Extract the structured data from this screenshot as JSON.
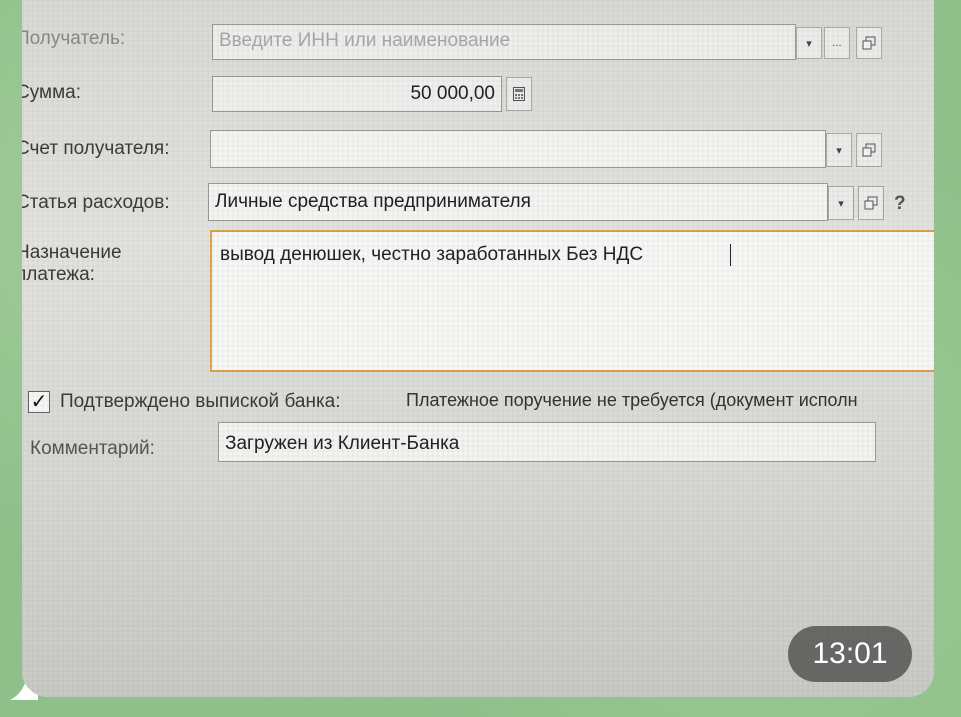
{
  "form": {
    "recipient_label": "Получатель:",
    "recipient_placeholder": "Введите ИНН или наименование",
    "amount_label": "Сумма:",
    "amount_value": "50 000,00",
    "account_label": "Счет получателя:",
    "account_value": "",
    "expense_label": "Статья расходов:",
    "expense_value": "Личные средства предпринимателя",
    "help_mark": "?",
    "purpose_label_line1": "Назначение",
    "purpose_label_line2": "платежа:",
    "purpose_value": "вывод денюшек, честно заработанных Без НДС",
    "bank_confirm_label": "Подтверждено выпиской банка:",
    "bank_confirm_checked": true,
    "bank_confirm_check_glyph": "✓",
    "payment_order_note": "Платежное поручение не требуется (документ исполн",
    "comment_label": "Комментарий:",
    "comment_value": "Загружен из Клиент-Банка",
    "ellipsis_label": "..."
  },
  "message": {
    "time": "13:01"
  },
  "icons": {
    "dropdown": "chevron-down-icon",
    "open": "open-window-icon",
    "calculator": "calculator-icon"
  },
  "colors": {
    "active_border": "#e0a24a",
    "chat_background": "#8fc08a"
  }
}
